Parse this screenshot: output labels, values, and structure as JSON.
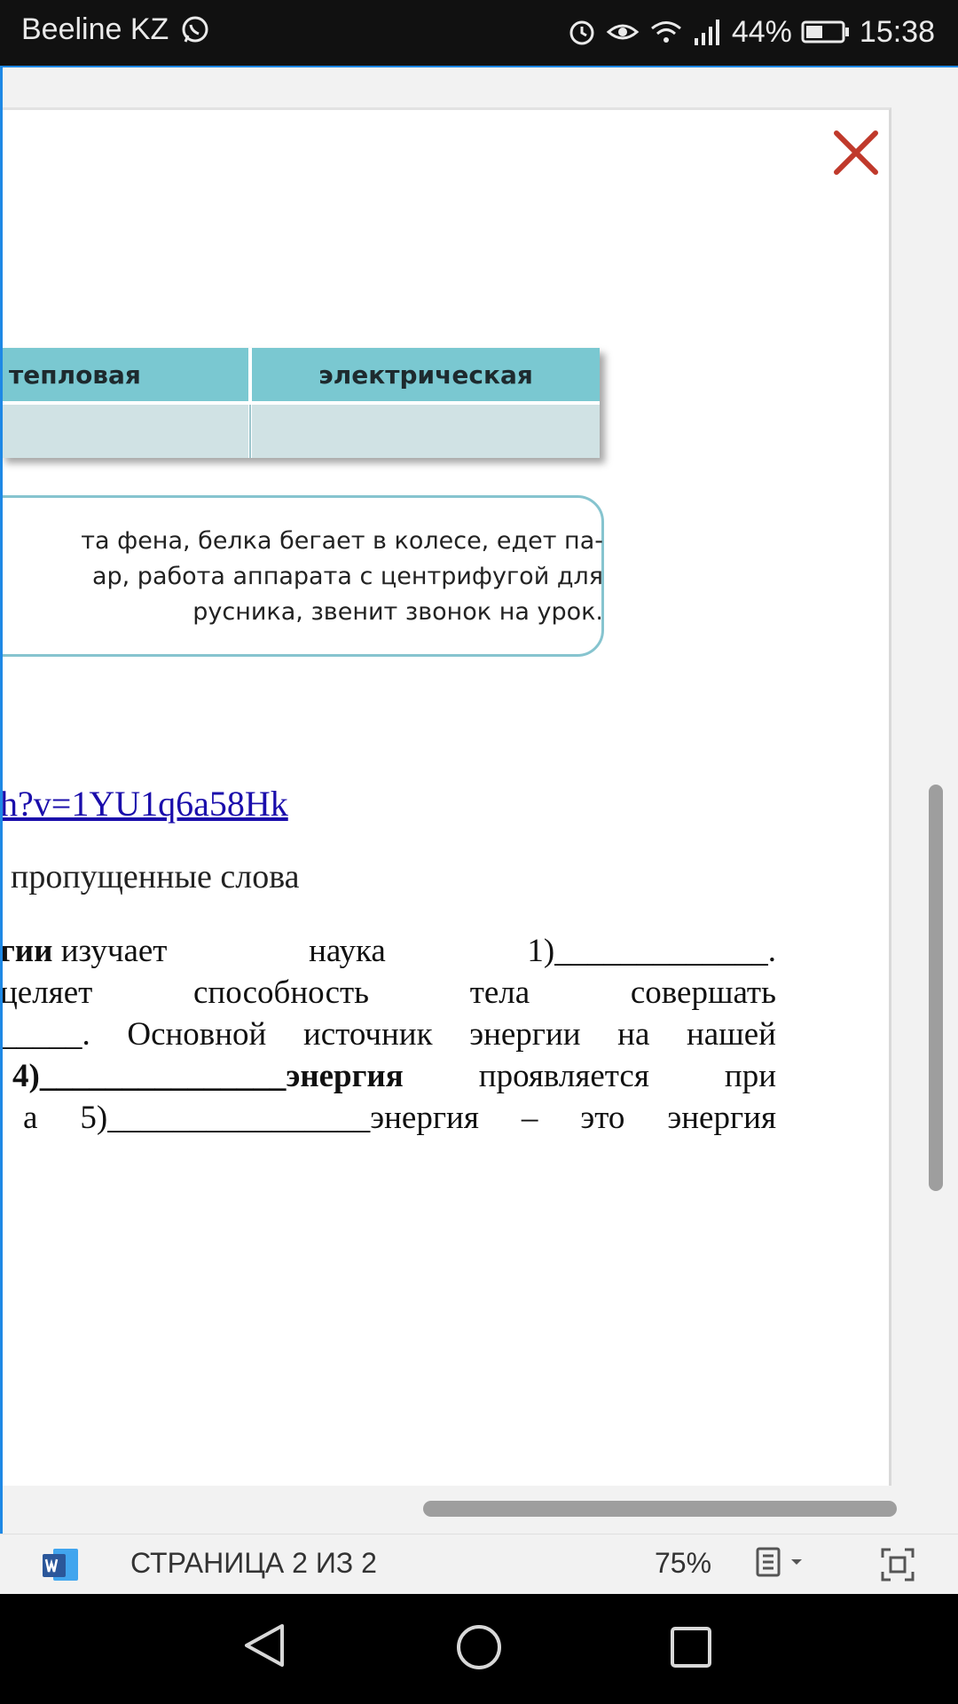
{
  "status_bar": {
    "carrier": "Beeline KZ",
    "battery": "44%",
    "time": "15:38"
  },
  "table": {
    "headers": [
      "тепловая",
      "электрическая"
    ]
  },
  "box": {
    "lines": [
      "та фена, белка бегает в колесе, едет па-",
      "ар, работа аппарата с центрифугой для",
      "русника, звенит звонок на урок."
    ]
  },
  "link": "h?v=1YU1q6a58Hk",
  "heading": "пропущенные слова",
  "paragraph": {
    "l1": [
      "гии",
      "изучает",
      "наука",
      "1)_____________."
    ],
    "l2": [
      "целяет",
      "способность",
      "тела",
      "совершать"
    ],
    "l3": [
      "_____.",
      "Основной",
      "источник",
      "энергии",
      "на",
      "нашей"
    ],
    "l4": [
      "4)_______________",
      "энергия",
      "проявляется",
      "при"
    ],
    "l5": [
      "а",
      "5)________________энергия",
      "–",
      "это",
      "энергия"
    ]
  },
  "bottom_bar": {
    "page_label": "СТРАНИЦА 2 ИЗ 2",
    "zoom": "75%"
  },
  "colors": {
    "accent": "#1e88e5",
    "close": "#c0392b",
    "table_header": "#7ac8d1",
    "table_cell": "#d0e2e4",
    "box_border": "#86c4cf",
    "link": "#1a0dab",
    "word_icon": "#2b579a"
  }
}
